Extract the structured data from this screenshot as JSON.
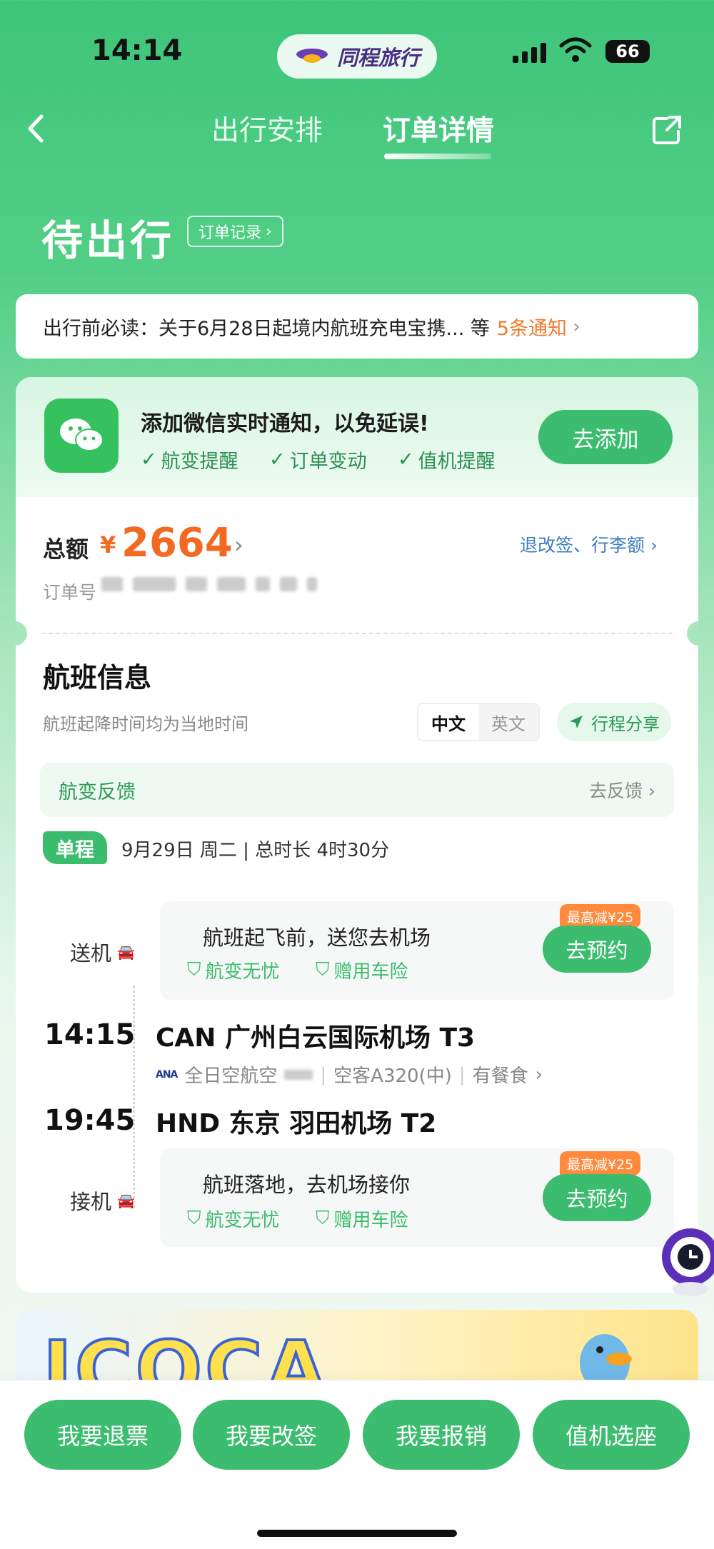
{
  "status_bar": {
    "time": "14:14",
    "app_name": "同程旅行",
    "battery": "66"
  },
  "header": {
    "tabs": [
      {
        "label": "出行安排"
      },
      {
        "label": "订单详情"
      }
    ]
  },
  "order_status": {
    "title": "待出行",
    "record_button": "订单记录"
  },
  "notice": {
    "text": "出行前必读：关于6月28日起境内航班充电宝携... 等",
    "count_text": "5条通知"
  },
  "wechat_banner": {
    "title": "添加微信实时通知，以免延误!",
    "features": [
      "航变提醒",
      "订单变动",
      "值机提醒"
    ],
    "button": "去添加"
  },
  "order": {
    "total_label": "总额",
    "currency": "¥",
    "amount": "2664",
    "refund_link": "退改签、行李额",
    "order_no_label": "订单号"
  },
  "flight_info": {
    "title": "航班信息",
    "subtitle": "航班起降时间均为当地时间",
    "lang_options": [
      "中文",
      "英文"
    ],
    "share_label": "行程分享",
    "feedback_label": "航变反馈",
    "feedback_link": "去反馈",
    "trip_type": "单程",
    "trip_meta": "9月29日 周二 | 总时长 4时30分"
  },
  "services": [
    {
      "side_label": "送机",
      "title": "航班起飞前，送您去机场",
      "tags": [
        "航变无忧",
        "赠用车险"
      ],
      "badge": "最高减¥25",
      "button": "去预约"
    },
    {
      "side_label": "接机",
      "title": "航班落地，去机场接你",
      "tags": [
        "航变无忧",
        "赠用车险"
      ],
      "badge": "最高减¥25",
      "button": "去预约"
    }
  ],
  "segments": {
    "depart_time": "14:15",
    "depart_airport": "CAN 广州白云国际机场 T3",
    "airline": "全日空航空",
    "aircraft": "空客A320(中)",
    "meal": "有餐食",
    "arrive_time": "19:45",
    "arrive_airport": "HND 东京 羽田机场 T2",
    "airline_logo": "ANA"
  },
  "promo": {
    "text": "ICOCA"
  },
  "bottom_actions": [
    "我要退票",
    "我要改签",
    "我要报销",
    "值机选座"
  ],
  "colors": {
    "primary": "#3cbc6e",
    "price": "#f26a22",
    "link": "#3c7cc0",
    "badge": "#ff8a3d"
  }
}
